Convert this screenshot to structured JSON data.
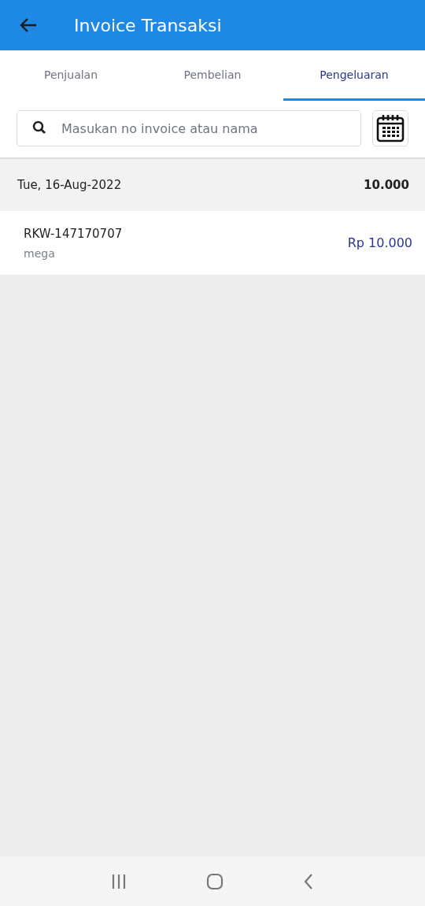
{
  "app_bar": {
    "title": "Invoice Transaksi"
  },
  "tabs": [
    {
      "label": "Penjualan",
      "selected": false
    },
    {
      "label": "Pembelian",
      "selected": false
    },
    {
      "label": "Pengeluaran",
      "selected": true
    }
  ],
  "search": {
    "placeholder": "Masukan no invoice atau nama"
  },
  "groups": [
    {
      "date": "Tue, 16-Aug-2022",
      "total": "10.000",
      "items": [
        {
          "invoice": "RKW-147170707",
          "name": "mega",
          "amount": "Rp 10.000"
        }
      ]
    }
  ]
}
